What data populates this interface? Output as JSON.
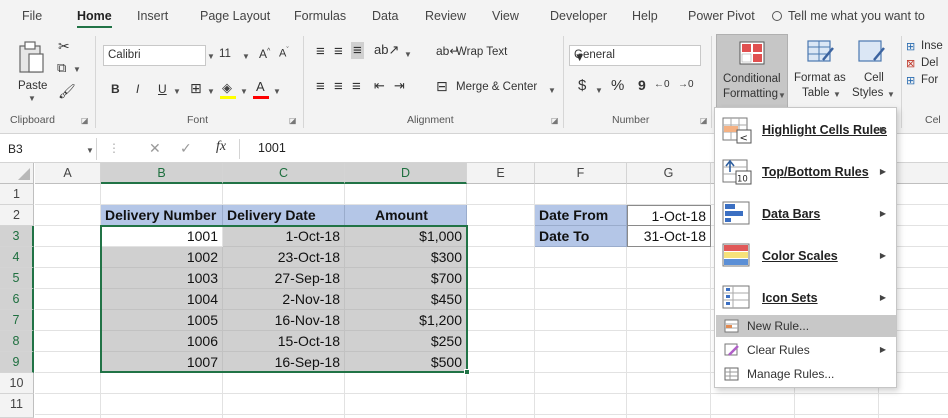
{
  "ribbon_tabs": [
    "File",
    "Home",
    "Insert",
    "Page Layout",
    "Formulas",
    "Data",
    "Review",
    "View",
    "Developer",
    "Help",
    "Power Pivot"
  ],
  "tell_me": "Tell me what you want to",
  "clipboard": {
    "paste": "Paste",
    "group": "Clipboard"
  },
  "font": {
    "name": "Calibri",
    "size": "11",
    "group": "Font",
    "bold": "B",
    "italic": "I",
    "underline": "U"
  },
  "alignment": {
    "wrap_text": "Wrap Text",
    "merge_center": "Merge & Center",
    "group": "Alignment"
  },
  "number": {
    "format": "General",
    "currency": "$",
    "percent": "%",
    "comma": "9",
    "group": "Number"
  },
  "styles": {
    "conditional_formatting": [
      "Conditional",
      "Formatting"
    ],
    "format_as_table": [
      "Format as",
      "Table"
    ],
    "cell_styles": [
      "Cell",
      "Styles"
    ]
  },
  "cells_group": {
    "insert": "Inse",
    "delete": "Del",
    "format": "For",
    "group": "Cel"
  },
  "formula_bar": {
    "name_box": "B3",
    "fx": "fx",
    "value": "1001"
  },
  "sheet": {
    "columns": [
      "A",
      "B",
      "C",
      "D",
      "E",
      "F",
      "G"
    ],
    "rows": [
      "1",
      "2",
      "3",
      "4",
      "5",
      "6",
      "7",
      "8",
      "9",
      "10",
      "11"
    ],
    "table_headers": [
      "Delivery Number",
      "Delivery Date",
      "Amount"
    ],
    "table_rows": [
      [
        "1001",
        "1-Oct-18",
        "$1,000"
      ],
      [
        "1002",
        "23-Oct-18",
        "$300"
      ],
      [
        "1003",
        "27-Sep-18",
        "$700"
      ],
      [
        "1004",
        "2-Nov-18",
        "$450"
      ],
      [
        "1005",
        "16-Nov-18",
        "$1,200"
      ],
      [
        "1006",
        "15-Oct-18",
        "$250"
      ],
      [
        "1007",
        "16-Sep-18",
        "$500"
      ]
    ],
    "date_from_label": "Date From",
    "date_from_value": "1-Oct-18",
    "date_to_label": "Date To",
    "date_to_value": "31-Oct-18"
  },
  "cf_menu": {
    "highlight_cells_rules": "Highlight Cells Rules",
    "top_bottom_rules": "Top/Bottom Rules",
    "data_bars": "Data Bars",
    "color_scales": "Color Scales",
    "icon_sets": "Icon Sets",
    "new_rule": "New Rule...",
    "clear_rules": "Clear Rules",
    "manage_rules": "Manage Rules..."
  },
  "colors": {
    "header_fill": "#B4C6E7",
    "selection_fill": "#D0D0D0",
    "excel_green": "#217346"
  }
}
